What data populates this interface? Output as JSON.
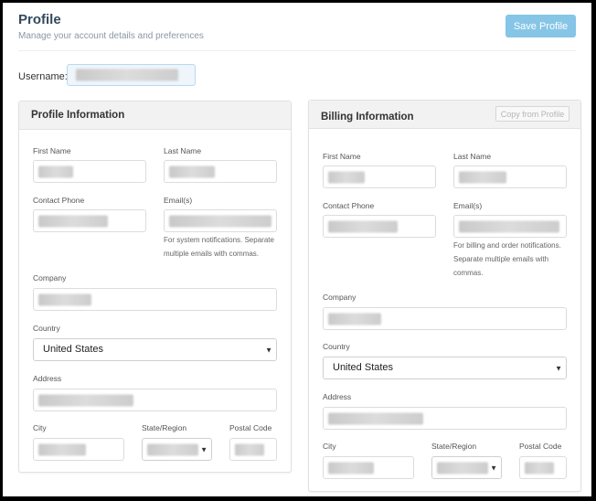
{
  "header": {
    "title": "Profile",
    "subtitle": "Manage your account details and preferences",
    "save_label": "Save Profile"
  },
  "username": {
    "label": "Username:"
  },
  "profile_panel": {
    "title": "Profile Information",
    "first_name_label": "First Name",
    "last_name_label": "Last Name",
    "contact_phone_label": "Contact Phone",
    "emails_label": "Email(s)",
    "emails_help_1": "For system notifications. Separate",
    "emails_help_2": "multiple emails with commas.",
    "company_label": "Company",
    "country_label": "Country",
    "country_value": "United States",
    "address_label": "Address",
    "city_label": "City",
    "state_label": "State/Region",
    "postal_label": "Postal Code"
  },
  "billing_panel": {
    "title": "Billing Information",
    "copy_label": "Copy from Profile",
    "first_name_label": "First Name",
    "last_name_label": "Last Name",
    "contact_phone_label": "Contact Phone",
    "emails_label": "Email(s)",
    "emails_help_1": "For billing and order notifications.",
    "emails_help_2": "Separate multiple emails with",
    "emails_help_3": "commas.",
    "company_label": "Company",
    "country_label": "Country",
    "country_value": "United States",
    "address_label": "Address",
    "city_label": "City",
    "state_label": "State/Region",
    "postal_label": "Postal Code"
  },
  "icons": {
    "select_arrow": "chevron-down-icon"
  },
  "colors": {
    "primary_button": "#86c5e6",
    "title": "#34495e",
    "username_focus": "#eef5fb"
  }
}
